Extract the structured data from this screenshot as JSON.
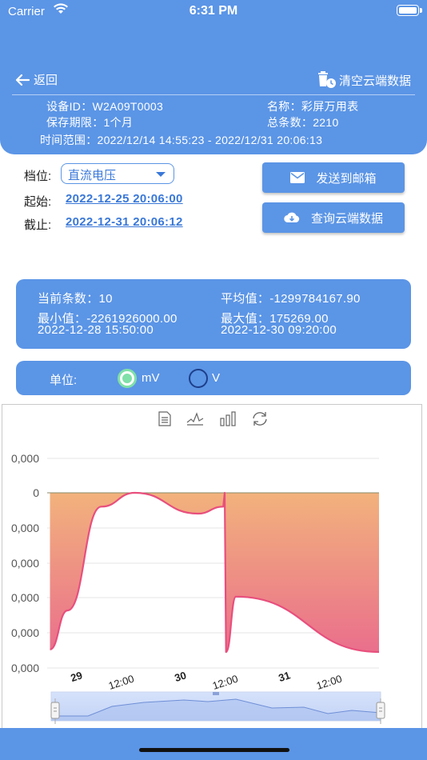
{
  "status_bar": {
    "carrier": "Carrier",
    "time": "6:31 PM"
  },
  "header": {
    "back_label": "返回",
    "clear_label": "清空云端数据",
    "device_id": "设备ID：W2A09T0003",
    "name": "名称：彩屏万用表",
    "retention": "保存期限：1个月",
    "total": "总条数：2210",
    "time_range": "时间范围：2022/12/14 14:55:23 - 2022/12/31 20:06:13"
  },
  "controls": {
    "gear_label": "档位:",
    "gear_value": "直流电压",
    "start_label": "起始:",
    "start_value": "2022-12-25 20:06:00",
    "end_label": "截止:",
    "end_value": "2022-12-31 20:06:12",
    "send_email_label": "发送到邮箱",
    "query_cloud_label": "查询云端数据"
  },
  "stats": {
    "count": "当前条数：10",
    "average": "平均值：-1299784167.90",
    "min": "最小值：-2261926000.00",
    "max": "最大值：175269.00",
    "min_time": "2022-12-28 15:50:00",
    "max_time": "2022-12-30 09:20:00"
  },
  "unit": {
    "label": "单位:",
    "options": [
      "mV",
      "V"
    ],
    "selected": "mV"
  },
  "toolbox_icons": [
    "data-view-icon",
    "line-chart-icon",
    "bar-chart-icon",
    "restore-icon"
  ],
  "colors": {
    "accent": "#5b95e6",
    "link": "#3a78d8",
    "series_line": "#e84f7d",
    "area_top": "#f2b27c",
    "area_bottom": "#ea6f8c",
    "radio_on": "#7fe0a8"
  },
  "chart_data": {
    "type": "area",
    "y_tick_labels": [
      "0,000",
      "0",
      "0,000",
      "0,000",
      "0,000",
      "0,000",
      "0,000"
    ],
    "x_tick_labels": [
      "29",
      "12:00",
      "30",
      "12:00",
      "31",
      "12:00"
    ],
    "x_bold_labels": [
      "29",
      "30",
      "31"
    ],
    "series": [
      {
        "x": [
          "2022-12-28 15:50",
          "2022-12-28 20:00",
          "2022-12-29 04:00",
          "2022-12-29 12:00",
          "2022-12-30 03:00",
          "2022-12-30 09:00",
          "2022-12-30 09:20",
          "2022-12-30 09:40",
          "2022-12-30 12:00",
          "2022-12-31 22:00"
        ],
        "y": [
          -2261926000,
          -1700000000,
          -200000000,
          175269,
          -300000000,
          -200000000,
          175269,
          -2300000000,
          -1500000000,
          -2300000000
        ]
      }
    ],
    "area_fill": "gradient",
    "grid": "horizontal",
    "data_zoom_slider": true
  }
}
